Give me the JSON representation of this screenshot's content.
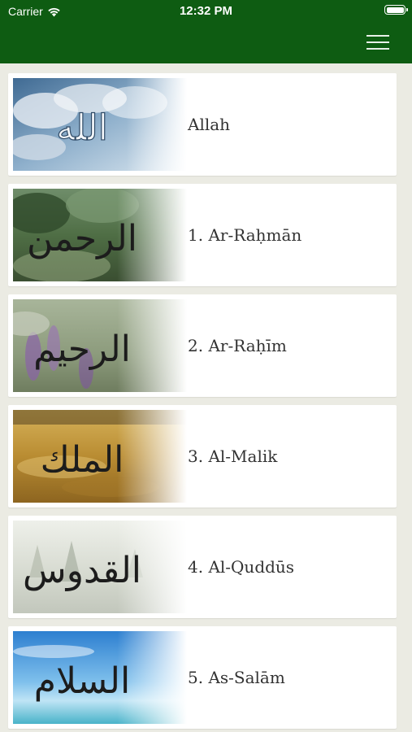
{
  "status_bar": {
    "carrier": "Carrier",
    "time": "12:32 PM"
  },
  "nav": {
    "menu_icon": "hamburger-menu-icon",
    "color": "#0e5c12"
  },
  "items": [
    {
      "label": "Allah",
      "calligraphy": "الله",
      "image": "cloudy-sky"
    },
    {
      "label": "1. Ar-Raḥmān",
      "calligraphy": "الرحمن",
      "image": "forest-meadow"
    },
    {
      "label": "2. Ar-Raḥīm",
      "calligraphy": "الرحيم",
      "image": "lavender-field"
    },
    {
      "label": "3. Al-Malik",
      "calligraphy": "الملك",
      "image": "golden-sand"
    },
    {
      "label": "4. Al-Quddūs",
      "calligraphy": "القدوس",
      "image": "misty-forest"
    },
    {
      "label": "5. As-Salām",
      "calligraphy": "السلام",
      "image": "blue-sky-sea"
    }
  ]
}
